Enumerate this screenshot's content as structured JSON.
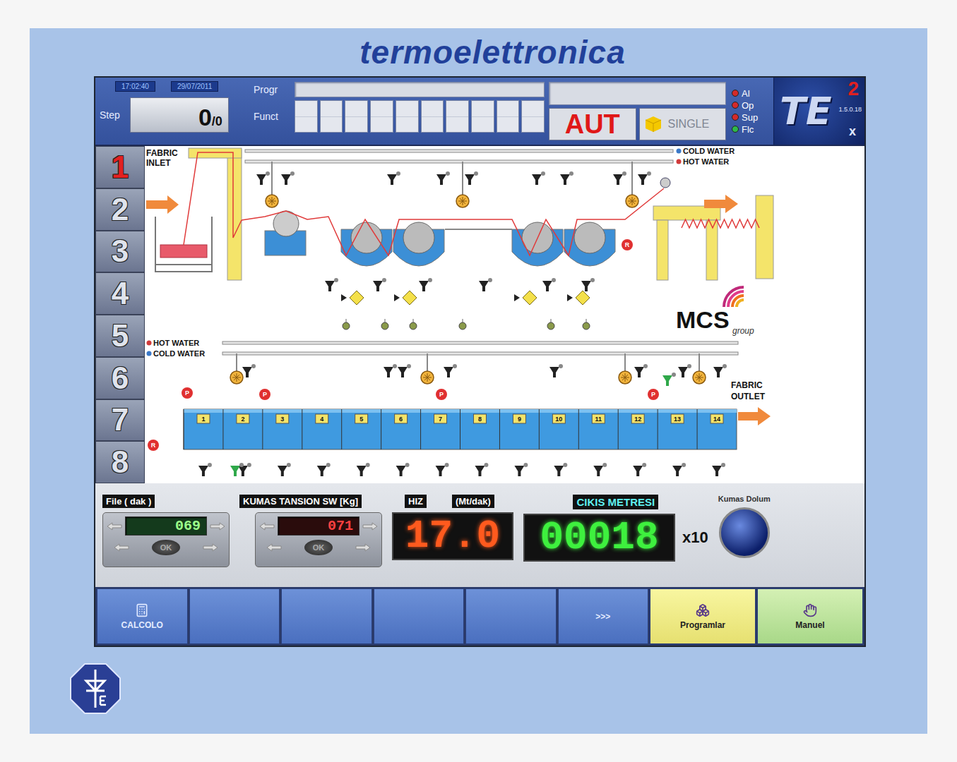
{
  "brand": {
    "name": "termoelettronica"
  },
  "header": {
    "time": "17:02:40",
    "date": "29/07/2011",
    "step_label": "Step",
    "step_value": "0",
    "step_total": "/0",
    "progr_label": "Progr",
    "progr_fields": [
      "",
      ""
    ],
    "funct_label": "Funct",
    "funct_cells": [
      "",
      "",
      "",
      "",
      "",
      "",
      "",
      "",
      "",
      ""
    ],
    "mode": "AUT",
    "cycle": "SINGLE",
    "indicators": [
      {
        "label": "Al",
        "color": "#d42a2a"
      },
      {
        "label": "Op",
        "color": "#d42a2a"
      },
      {
        "label": "Sup",
        "color": "#d42a2a"
      },
      {
        "label": "Flc",
        "color": "#2fb84a"
      }
    ],
    "logo": {
      "letters": "TE",
      "sup": "2",
      "sub": "x",
      "version": "1.5.0.18"
    }
  },
  "steps": [
    {
      "label": "1",
      "selected": true
    },
    {
      "label": "2",
      "selected": false
    },
    {
      "label": "3",
      "selected": false
    },
    {
      "label": "4",
      "selected": false
    },
    {
      "label": "5",
      "selected": false
    },
    {
      "label": "6",
      "selected": false
    },
    {
      "label": "7",
      "selected": false
    },
    {
      "label": "8",
      "selected": false
    }
  ],
  "diagram": {
    "inlet_lines": [
      "FABRIC",
      "INLET"
    ],
    "outlet_lines": [
      "FABRIC",
      "OUTLET"
    ],
    "top_pipes": [
      {
        "label": "COLD WATER",
        "color": "#3a78c8"
      },
      {
        "label": "HOT WATER",
        "color": "#d03a3a"
      }
    ],
    "bottom_pipes": [
      {
        "label": "HOT WATER",
        "color": "#d03a3a"
      },
      {
        "label": "COLD WATER",
        "color": "#3a78c8"
      }
    ],
    "tanks": [
      "1",
      "2",
      "3",
      "4",
      "5",
      "6",
      "7",
      "8",
      "9",
      "10",
      "11",
      "12",
      "13",
      "14"
    ],
    "recirc_label": "R",
    "pump_label": "P",
    "mcs": {
      "name": "MCS",
      "sub": "group"
    }
  },
  "controls": {
    "file": {
      "label": "File ( dak )",
      "value": "069"
    },
    "tension": {
      "label": "KUMAS TANSION SW [Kg]",
      "value": "071"
    },
    "stepper_ok": "OK",
    "speed": {
      "label": "HIZ",
      "unit": "(Mt/dak)",
      "value": "17.0"
    },
    "meter": {
      "label": "CIKIS METRESI",
      "value": "00018",
      "multiplier": "x10"
    },
    "fill": {
      "label": "Kumas Dolum"
    }
  },
  "toolbar": [
    {
      "label": "CALCOLO",
      "kind": "calc"
    },
    {
      "label": "",
      "kind": "blank"
    },
    {
      "label": "",
      "kind": "blank"
    },
    {
      "label": "",
      "kind": "blank"
    },
    {
      "label": "",
      "kind": "blank"
    },
    {
      "label": ">>>",
      "kind": "blank"
    },
    {
      "label": "Programlar",
      "kind": "programs"
    },
    {
      "label": "Manuel",
      "kind": "manual"
    }
  ]
}
